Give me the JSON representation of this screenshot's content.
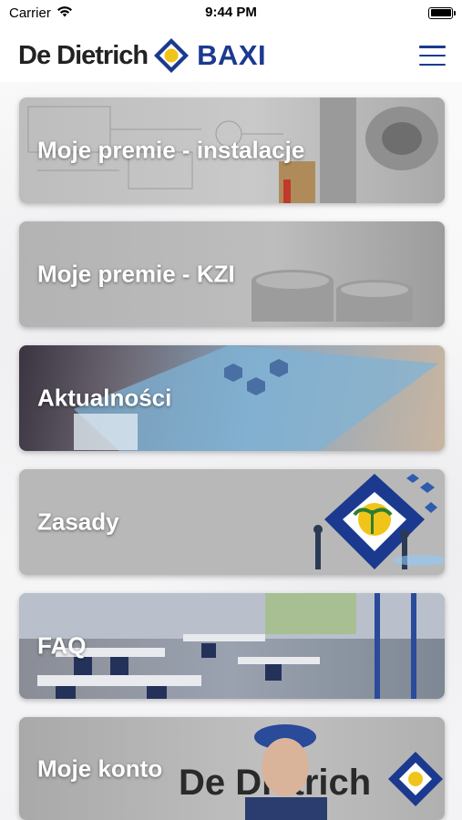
{
  "status_bar": {
    "carrier": "Carrier",
    "time": "9:44 PM"
  },
  "header": {
    "logo_left": "De Dietrich",
    "logo_right": "BAXI",
    "brand_color": "#1b3a8f"
  },
  "cards": [
    {
      "label": "Moje premie - instalacje"
    },
    {
      "label": "Moje premie - KZI"
    },
    {
      "label": "Aktualności"
    },
    {
      "label": "Zasady"
    },
    {
      "label": "FAQ"
    },
    {
      "label": "Moje konto"
    }
  ],
  "card_images": {
    "card_6_watermark": "De Dietrich"
  }
}
